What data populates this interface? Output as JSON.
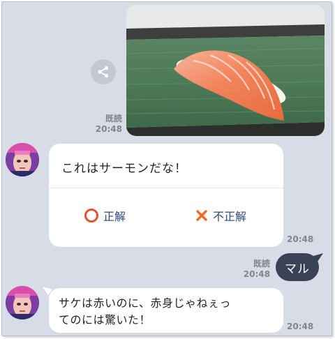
{
  "messages": {
    "photo": {
      "read_label": "既読",
      "time": "20:48"
    },
    "quiz": {
      "question": "これはサーモンだな！",
      "option_correct": "正解",
      "option_incorrect": "不正解",
      "time": "20:48"
    },
    "user_reply": {
      "text": "マル",
      "read_label": "既読",
      "time": "20:48"
    },
    "bot_reply": {
      "line1": "サケは赤いのに、赤身じゃねぇっ",
      "line2": "てのには驚いた！",
      "time": "20:48"
    }
  },
  "colors": {
    "background": "#d7dce6",
    "bubble": "#ffffff",
    "user_bubble": "#3a4257",
    "correct_icon": "#e8502e",
    "incorrect_icon": "#ef6a22",
    "option_text": "#2e4a7a"
  },
  "icons": {
    "share": "share-icon",
    "correct": "circle-icon",
    "incorrect": "cross-icon"
  }
}
